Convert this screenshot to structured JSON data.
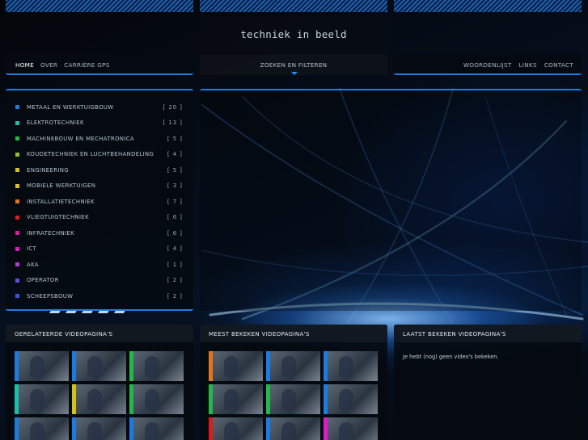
{
  "site": {
    "logo_text": "techniek in beeld"
  },
  "nav_left": [
    "HOME",
    "OVER",
    "CARRIÈRE GPS"
  ],
  "nav_mid": "ZOEKEN EN FILTEREN",
  "nav_right": [
    "WOORDENLIJST",
    "LINKS",
    "CONTACT"
  ],
  "categories": [
    {
      "label": "METAAL EN WERKTUIGBOUW",
      "count": "[ 20 ]",
      "color": "#1a7be0"
    },
    {
      "label": "ELEKTROTECHNIEK",
      "count": "[ 13 ]",
      "color": "#19c0a8"
    },
    {
      "label": "MACHINEBOUW EN MECHATRONICA",
      "count": "[ 5 ]",
      "color": "#22b84a"
    },
    {
      "label": "KOUDETECHNIEK EN LUCHTBEHANDELING",
      "count": "[ 4 ]",
      "color": "#8ec22a"
    },
    {
      "label": "ENGINEERING",
      "count": "[ 5 ]",
      "color": "#d2c21a"
    },
    {
      "label": "MOBIELE WERKTUIGEN",
      "count": "[ 3 ]",
      "color": "#e0c21a"
    },
    {
      "label": "INSTALLATIETECHNIEK",
      "count": "[ 7 ]",
      "color": "#e8741a"
    },
    {
      "label": "VLIEGTUIGTECHNIEK",
      "count": "[ 6 ]",
      "color": "#e01a1a"
    },
    {
      "label": "INFRATECHNIEK",
      "count": "[ 6 ]",
      "color": "#e01aa0"
    },
    {
      "label": "ICT",
      "count": "[ 4 ]",
      "color": "#e01ac8"
    },
    {
      "label": "AKA",
      "count": "[ 1 ]",
      "color": "#b63ad8"
    },
    {
      "label": "OPERATOR",
      "count": "[ 2 ]",
      "color": "#6a4ae0"
    },
    {
      "label": "SCHEEPSBOUW",
      "count": "[ 2 ]",
      "color": "#3a56e0"
    }
  ],
  "panels": {
    "related": {
      "title": "GERELATEERDE VIDEOPAGINA'S",
      "thumb_colors": [
        "#1a7be0",
        "#1a7be0",
        "#22b84a",
        "#19c0a8",
        "#d2c21a",
        "#22b84a",
        "#1a7be0",
        "#1a7be0",
        "#1a7be0"
      ]
    },
    "most_viewed": {
      "title": "MEEST BEKEKEN VIDEOPAGINA'S",
      "thumb_colors": [
        "#e8741a",
        "#1a7be0",
        "#1a7be0",
        "#22b84a",
        "#22b84a",
        "#1a7be0",
        "#e01a1a",
        "#1a7be0",
        "#e01ac8"
      ]
    },
    "last_viewed": {
      "title": "LAATST BEKEKEN VIDEOPAGINA'S",
      "message": "Je hebt (nog) geen video's bekeken."
    }
  }
}
